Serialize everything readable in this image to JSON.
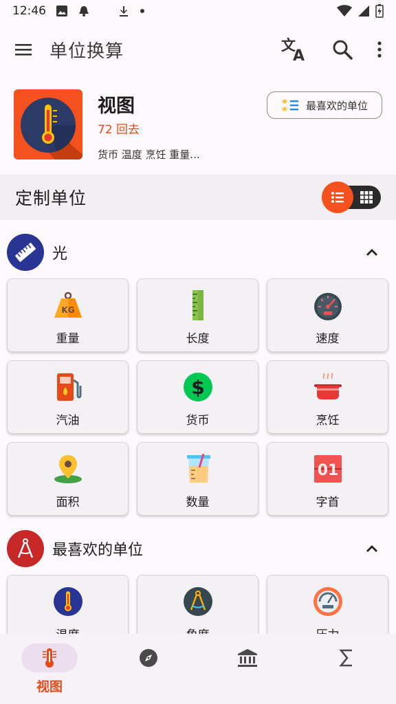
{
  "status": {
    "time": "12:46"
  },
  "appbar": {
    "title": "单位换算"
  },
  "header": {
    "title": "视图",
    "subtitle": "72 回去",
    "tags": "货币 温度 烹饪 重量...",
    "favorites_button": "最喜欢的单位"
  },
  "custom_bar": {
    "label": "定制单位"
  },
  "sections": {
    "light": {
      "name": "光",
      "tiles": [
        "重量",
        "长度",
        "速度",
        "汽油",
        "货币",
        "烹饪",
        "面积",
        "数量",
        "字首"
      ]
    },
    "favorites": {
      "name": "最喜欢的单位",
      "tiles": [
        "温度",
        "角度",
        "压力"
      ]
    }
  },
  "bottom_nav": {
    "active_label": "视图"
  },
  "colors": {
    "accent": "#f4511e",
    "accent_text": "#e64a19",
    "nav_active_bg": "#ebdfef"
  }
}
